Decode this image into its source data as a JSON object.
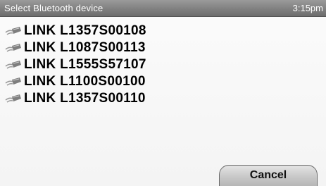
{
  "titlebar": {
    "title": "Select Bluetooth device",
    "time": "3:15pm"
  },
  "devices": [
    {
      "label": "LINK L1357S00108",
      "icon": "bluetooth-device-icon"
    },
    {
      "label": "LINK L1087S00113",
      "icon": "bluetooth-device-icon"
    },
    {
      "label": "LINK L1555S57107",
      "icon": "bluetooth-device-icon"
    },
    {
      "label": "LINK L1100S00100",
      "icon": "bluetooth-device-icon"
    },
    {
      "label": "LINK L1357S00110",
      "icon": "bluetooth-device-icon"
    }
  ],
  "actions": {
    "cancel_label": "Cancel"
  }
}
